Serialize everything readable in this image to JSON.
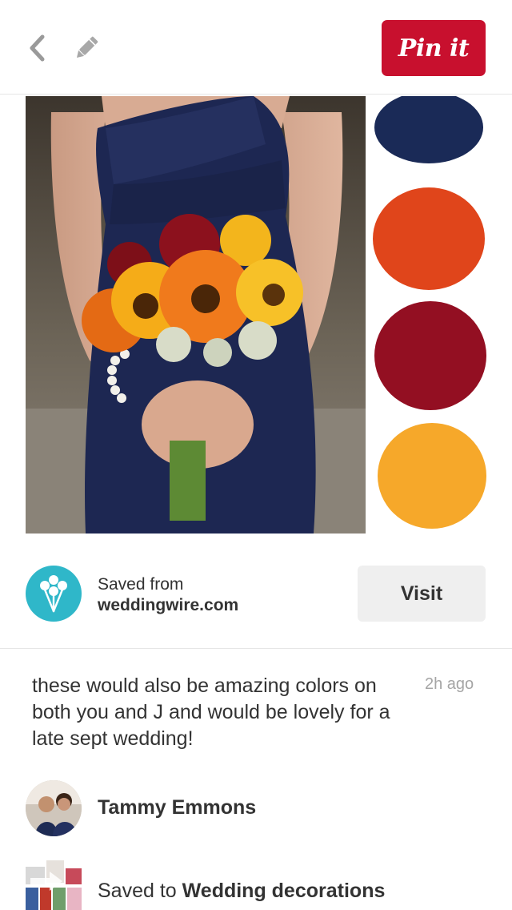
{
  "toolbar": {
    "back_icon": "chevron-left-icon",
    "edit_icon": "pencil-icon",
    "pin_button_label": "Pin it",
    "pin_button_color": "#c8102e"
  },
  "pin": {
    "image_description_colors": {
      "navy": "#1a2a57",
      "orange": "#e0451b",
      "burgundy": "#930f22",
      "gold": "#f6a82a"
    }
  },
  "source": {
    "label": "Saved from",
    "domain": "weddingwire.com",
    "logo_color": "#2fb7c9",
    "visit_label": "Visit"
  },
  "comment": {
    "text": "these would also be amazing colors on both you and J and would be lovely for a late sept wedding!",
    "timestamp": "2h ago"
  },
  "pinner": {
    "name": "Tammy Emmons"
  },
  "board": {
    "prefix": "Saved to",
    "name": "Wedding decorations"
  }
}
